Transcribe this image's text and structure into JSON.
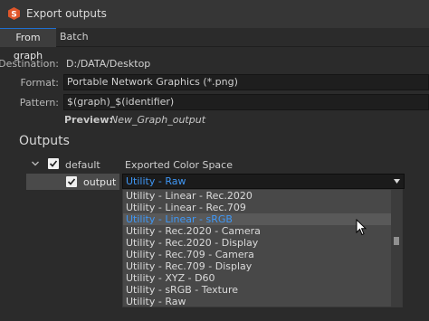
{
  "window": {
    "title": "Export outputs"
  },
  "tabs": [
    {
      "label": "From graph",
      "active": true
    },
    {
      "label": "Batch",
      "active": false
    }
  ],
  "form": {
    "destination_label": "Destination:",
    "destination_value": "D:/DATA/Desktop",
    "format_label": "Format:",
    "format_value": "Portable Network Graphics (*.png)",
    "pattern_label": "Pattern:",
    "pattern_value": "$(graph)_$(identifier)",
    "preview_label": "Preview:",
    "preview_value": "New_Graph_output"
  },
  "outputs": {
    "heading": "Outputs",
    "group_label": "default",
    "group_checked": true,
    "column_header": "Exported Color Space",
    "item_label": "output",
    "item_checked": true,
    "selected_color_space": "Utility - Raw"
  },
  "dropdown": {
    "items": [
      "Utility - Linear - Rec.2020",
      "Utility - Linear - Rec.709",
      "Utility - Linear - sRGB",
      "Utility - Rec.2020 - Camera",
      "Utility - Rec.2020 - Display",
      "Utility - Rec.709 - Camera",
      "Utility - Rec.709 - Display",
      "Utility - XYZ - D60",
      "Utility - sRGB - Texture",
      "Utility - Raw"
    ],
    "highlighted_item": "Utility - Linear - sRGB"
  },
  "colors": {
    "accent": "#3f97f5",
    "app_icon": "#e0562a",
    "background": "#2b2b2b"
  }
}
